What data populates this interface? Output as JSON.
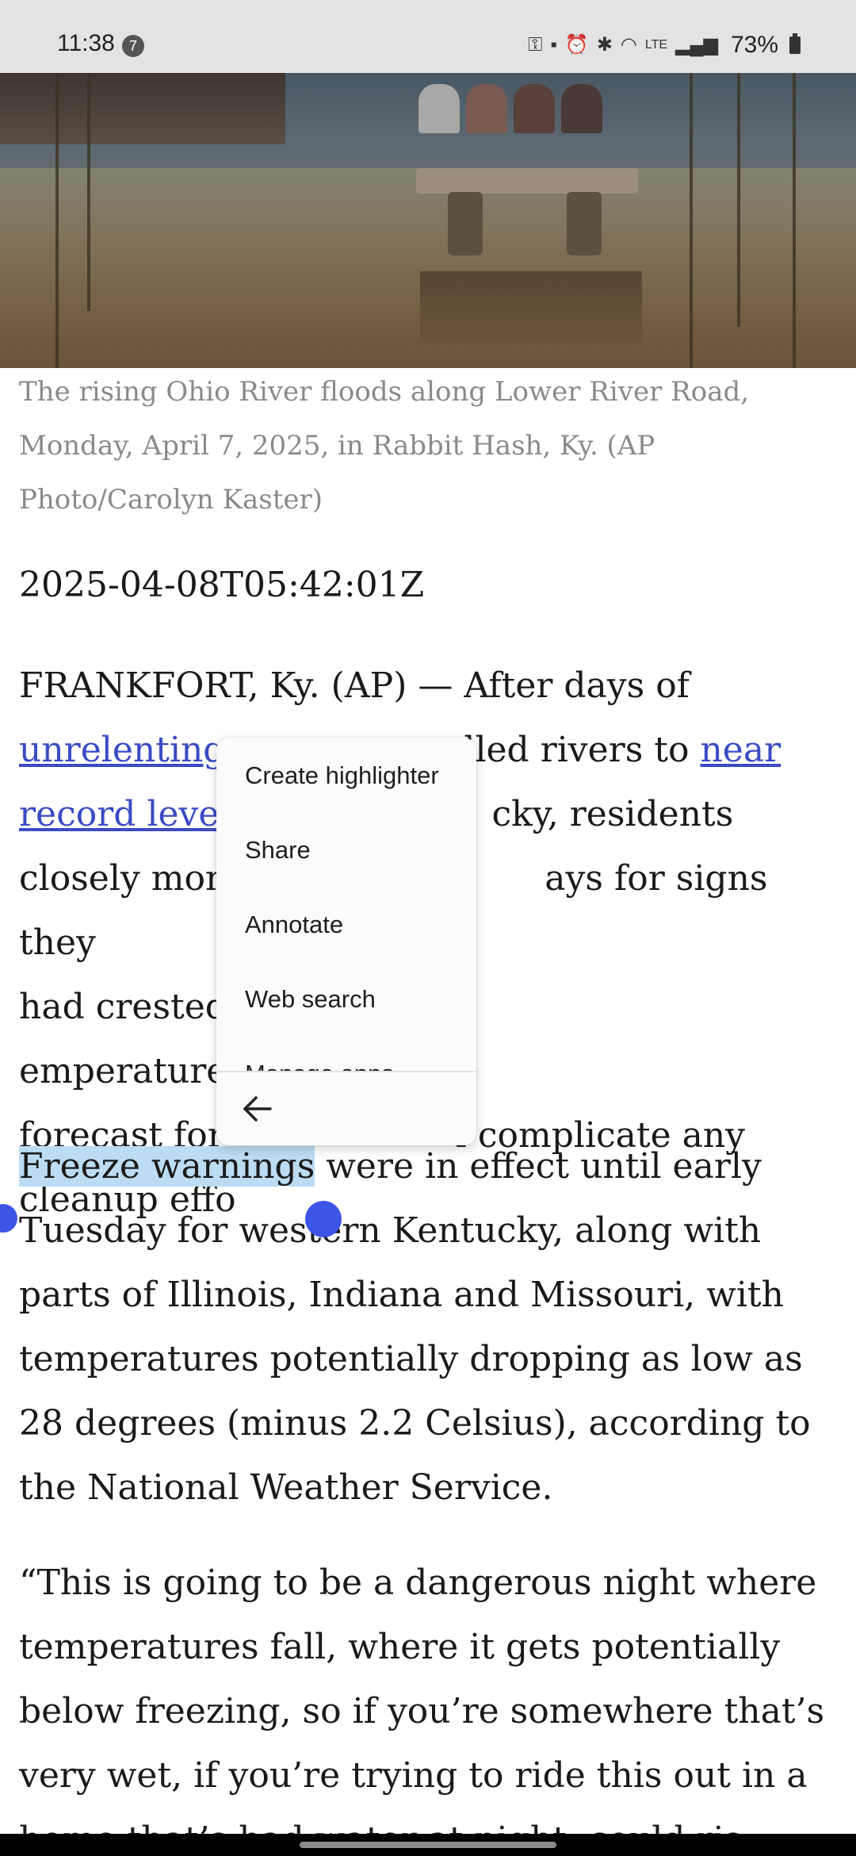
{
  "status_bar": {
    "time": "11:38",
    "notification_count": "7",
    "battery": "73%"
  },
  "article": {
    "caption": "The rising Ohio River floods along Lower River Road, Monday, April 7, 2025, in Rabbit Hash, Ky. (AP Photo/Carolyn Kaster)",
    "date": "2025-04-08T05:42:01Z",
    "p1": {
      "a": "FRANKFORT, Ky. (AP) — After days of ",
      "link1": "unrelenting",
      "b": " ",
      "c": "velled rivers to ",
      "link2a": "near",
      "link2b": "record level",
      "d": "cky, residents",
      "line3": "closely mon",
      "line3b": "ays for signs they",
      "line4": "had crested",
      "line4b": "emperatures",
      "line5": "forecast for",
      "line5b": "l complicate any",
      "line6": "cleanup effo"
    },
    "p2": {
      "selected": "Freeze warnings",
      "rest": " were in effect until early Tuesday for western Kentucky, along with parts of Illinois, Indiana and Missouri, with temperatures potentially dropping as low as 28 degrees (minus 2.2 Celsius), according to the National Weather Service."
    },
    "p3": "“This is going to be a dangerous night where temperatures fall, where it gets potentially below freezing, so if you’re somewhere that’s very wet, if you’re trying to ride this out in a home that’s had water at night, could ris"
  },
  "context_menu": {
    "items": [
      "Create highlighter",
      "Share",
      "Annotate",
      "Web search",
      "Manage apps"
    ]
  },
  "colors": {
    "link": "#3a4bc4",
    "selection": "#bcdcf3",
    "handle": "#3d55e6"
  }
}
